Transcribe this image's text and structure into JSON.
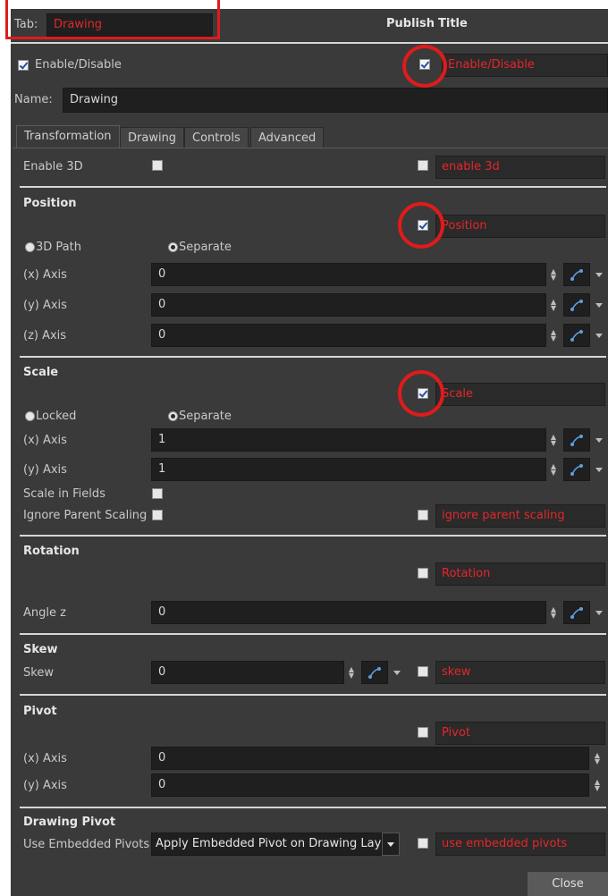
{
  "header": {
    "tab_label": "Tab:",
    "tab_value": "Drawing",
    "publish_label": "Publish",
    "title_label": "Title"
  },
  "enable": {
    "label": "Enable/Disable",
    "title": "Enable/Disable"
  },
  "name": {
    "label": "Name:",
    "value": "Drawing"
  },
  "tabs": [
    {
      "label": "Transformation"
    },
    {
      "label": "Drawing"
    },
    {
      "label": "Controls"
    },
    {
      "label": "Advanced"
    }
  ],
  "enable3d": {
    "label": "Enable 3D",
    "title": "enable 3d"
  },
  "position": {
    "header": "Position",
    "title": "Position",
    "radio_3dpath": "3D Path",
    "radio_separate": "Separate",
    "x_label": "(x) Axis",
    "x_value": "0",
    "y_label": "(y) Axis",
    "y_value": "0",
    "z_label": "(z) Axis",
    "z_value": "0"
  },
  "scale": {
    "header": "Scale",
    "title": "Scale",
    "radio_locked": "Locked",
    "radio_separate": "Separate",
    "x_label": "(x) Axis",
    "x_value": "1",
    "y_label": "(y) Axis",
    "y_value": "1",
    "fields_label": "Scale in Fields",
    "ignore_label": "Ignore Parent Scaling",
    "ignore_title": "ignore parent scaling"
  },
  "rotation": {
    "header": "Rotation",
    "title": "Rotation",
    "angle_label": "Angle z",
    "angle_value": "0"
  },
  "skew": {
    "header": "Skew",
    "label": "Skew",
    "value": "0",
    "title": "skew"
  },
  "pivot": {
    "header": "Pivot",
    "title": "Pivot",
    "x_label": "(x) Axis",
    "x_value": "0",
    "y_label": "(y) Axis",
    "y_value": "0"
  },
  "drawing_pivot": {
    "header": "Drawing Pivot",
    "label": "Use Embedded Pivots",
    "select_value": "Apply Embedded Pivot on Drawing Layer",
    "title": "use embedded pivots"
  },
  "close_label": "Close",
  "colors": {
    "accent_red": "#e01b1b",
    "title_text": "#e4262b",
    "panel_bg": "#3a3a3a"
  }
}
